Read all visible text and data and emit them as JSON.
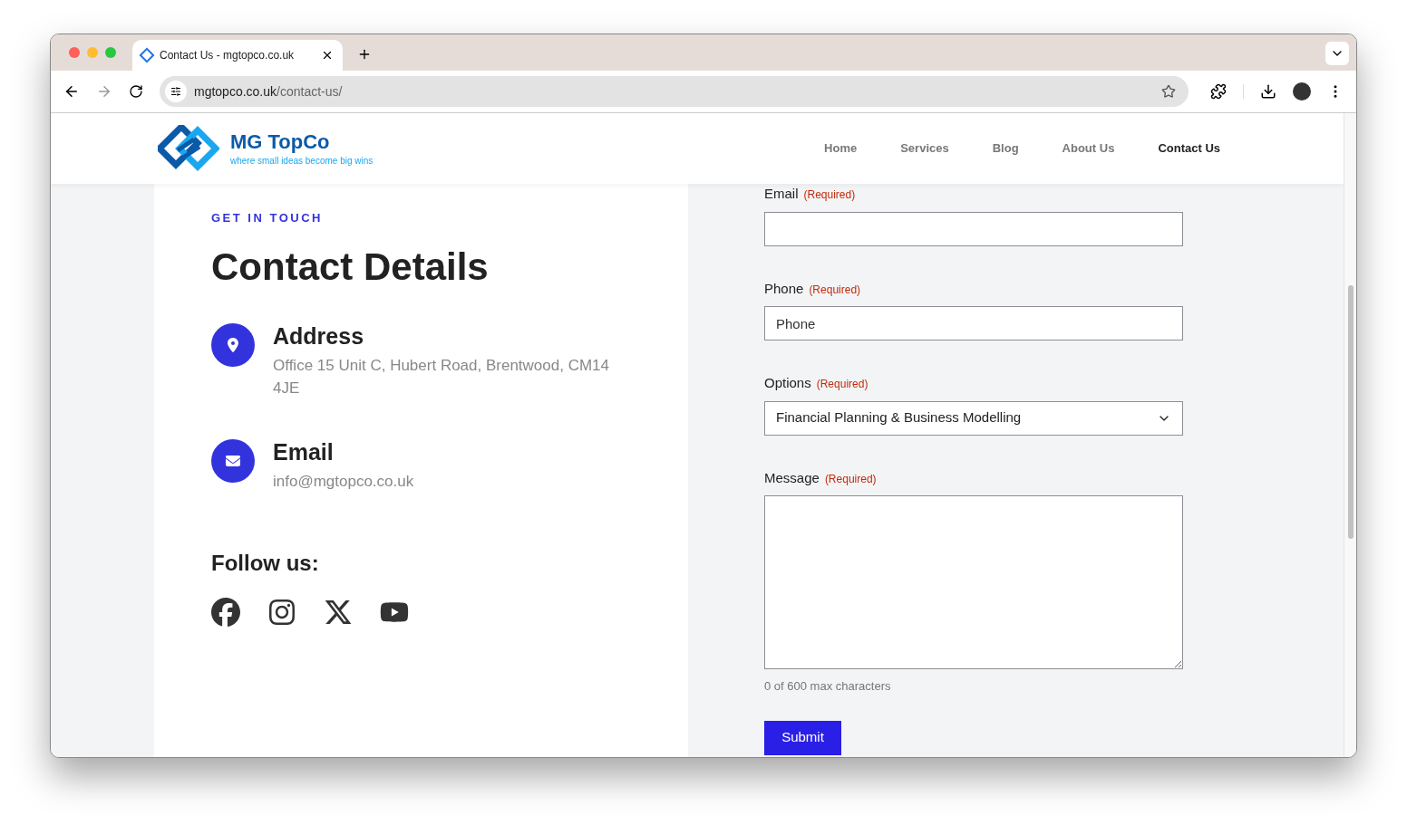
{
  "browser": {
    "tab_title": "Contact Us - mgtopco.co.uk",
    "url_host": "mgtopco.co.uk",
    "url_path": "/contact-us/"
  },
  "site": {
    "name": "MG TopCo",
    "tagline": "where small ideas become big wins",
    "nav": [
      {
        "label": "Home",
        "selected": false
      },
      {
        "label": "Services",
        "selected": false
      },
      {
        "label": "Blog",
        "selected": false
      },
      {
        "label": "About Us",
        "selected": false
      },
      {
        "label": "Contact Us",
        "selected": true
      }
    ]
  },
  "contact": {
    "eyebrow": "GET IN TOUCH",
    "heading": "Contact Details",
    "details": [
      {
        "kind": "address",
        "label": "Address",
        "value": "Office 15 Unit C, Hubert Road, Brentwood, CM14 4JE"
      },
      {
        "kind": "email",
        "label": "Email",
        "value": "info@mgtopco.co.uk"
      }
    ],
    "follow_label": "Follow us:",
    "socials": [
      {
        "kind": "facebook"
      },
      {
        "kind": "instagram"
      },
      {
        "kind": "x"
      },
      {
        "kind": "youtube"
      }
    ]
  },
  "form": {
    "fields": [
      {
        "kind": "text",
        "label": "Email",
        "required": "(Required)"
      },
      {
        "kind": "text",
        "label": "Phone",
        "required": "(Required)",
        "placeholder": "Phone"
      },
      {
        "kind": "select",
        "label": "Options",
        "required": "(Required)",
        "value": "Financial Planning & Business Modelling"
      },
      {
        "kind": "textarea",
        "label": "Message",
        "required": "(Required)",
        "counter": "0 of 600 max characters"
      }
    ],
    "submit": "Submit"
  }
}
